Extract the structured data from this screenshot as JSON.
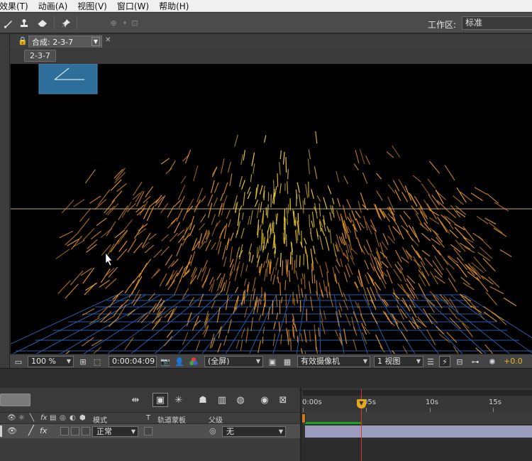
{
  "menu": {
    "items": [
      "效果(T)",
      "动画(A)",
      "视图(V)",
      "窗口(W)",
      "帮助(H)"
    ]
  },
  "toolbar": {
    "workspace_label": "工作区:",
    "workspace_value": "标准"
  },
  "composition": {
    "tab_label": "合成: 2-3-7",
    "breadcrumb": "2-3-7"
  },
  "viewer_controls": {
    "zoom": "100 %",
    "timecode": "0:00:04:09",
    "resolution": "(全屏)",
    "camera": "有效摄像机",
    "views": "1 视图",
    "exposure": "+0.0"
  },
  "timeline": {
    "columns": {
      "mode": "模式",
      "t": "T",
      "trkmat": "轨道蒙板",
      "parent": "父级"
    },
    "layer": {
      "mode": "正常",
      "parent": "无"
    },
    "ruler": [
      "0:00s",
      "05s",
      "10s",
      "15s"
    ]
  },
  "colors": {
    "viewer_bg": "#000000",
    "particle": "#e8962a",
    "particle_core": "#f4d030",
    "grid": "#2a5aa8",
    "layer_bar": "#9b9bbd",
    "work_area": "#1ea11e",
    "playhead": "#e03030",
    "accent": "#e6b020"
  },
  "icons": {
    "brush": "brush-icon",
    "stamp": "stamp-icon",
    "eraser": "eraser-icon",
    "pin": "puppet-pin-icon"
  }
}
